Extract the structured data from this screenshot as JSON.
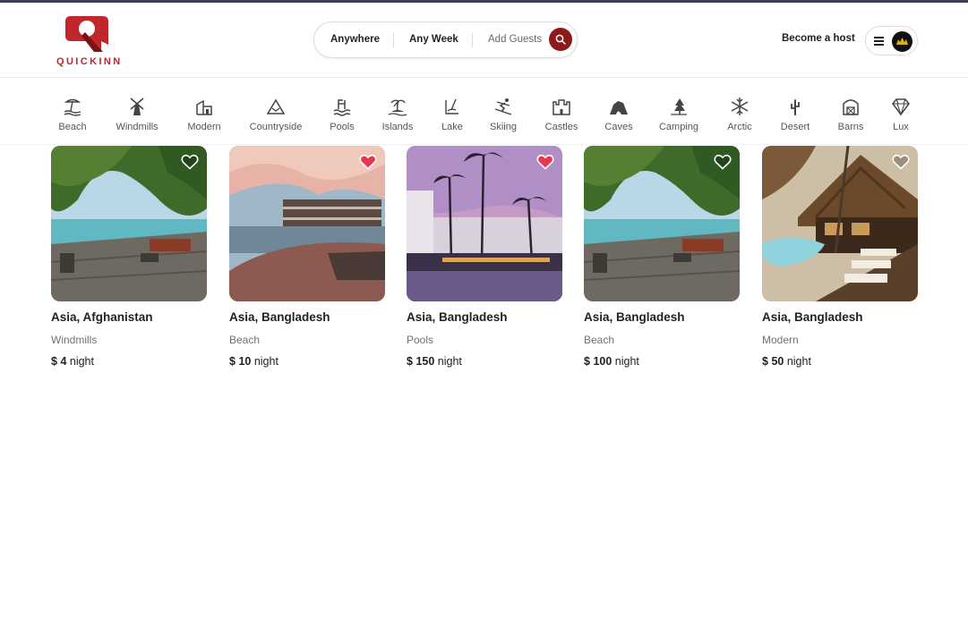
{
  "brand": {
    "name": "QUICKINN",
    "color": "#c0272d"
  },
  "search": {
    "anywhere_label": "Anywhere",
    "week_label": "Any Week",
    "guests_label": "Add Guests",
    "button_icon": "search-icon",
    "button_color": "#8b1a1a"
  },
  "header": {
    "host_label": "Become a host",
    "menu_icon": "hamburger-icon",
    "avatar_icon": "avatar"
  },
  "categories": [
    {
      "label": "Beach",
      "icon": "beach-icon"
    },
    {
      "label": "Windmills",
      "icon": "windmill-icon"
    },
    {
      "label": "Modern",
      "icon": "modern-house-icon"
    },
    {
      "label": "Countryside",
      "icon": "mountain-icon"
    },
    {
      "label": "Pools",
      "icon": "pool-icon"
    },
    {
      "label": "Islands",
      "icon": "island-icon"
    },
    {
      "label": "Lake",
      "icon": "lake-icon"
    },
    {
      "label": "Skiing",
      "icon": "skiing-icon"
    },
    {
      "label": "Castles",
      "icon": "castle-icon"
    },
    {
      "label": "Caves",
      "icon": "cave-icon"
    },
    {
      "label": "Camping",
      "icon": "camping-icon"
    },
    {
      "label": "Arctic",
      "icon": "snowflake-icon"
    },
    {
      "label": "Desert",
      "icon": "cactus-icon"
    },
    {
      "label": "Barns",
      "icon": "barn-icon"
    },
    {
      "label": "Lux",
      "icon": "diamond-icon"
    }
  ],
  "listings": [
    {
      "location": "Asia, Afghanistan",
      "category": "Windmills",
      "currency": "$",
      "price": "4",
      "unit": "night",
      "favorited": false
    },
    {
      "location": "Asia, Bangladesh",
      "category": "Beach",
      "currency": "$",
      "price": "10",
      "unit": "night",
      "favorited": true
    },
    {
      "location": "Asia, Bangladesh",
      "category": "Pools",
      "currency": "$",
      "price": "150",
      "unit": "night",
      "favorited": true
    },
    {
      "location": "Asia, Bangladesh",
      "category": "Beach",
      "currency": "$",
      "price": "100",
      "unit": "night",
      "favorited": false
    },
    {
      "location": "Asia, Bangladesh",
      "category": "Modern",
      "currency": "$",
      "price": "50",
      "unit": "night",
      "favorited": false
    }
  ],
  "colors": {
    "favorite": "#e8384f",
    "text": "#222222",
    "muted": "#717171"
  }
}
